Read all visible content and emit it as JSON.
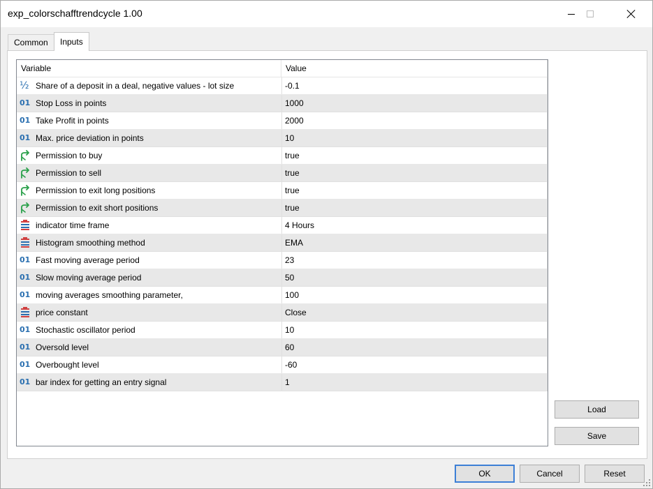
{
  "window": {
    "title": "exp_colorschafftrendcycle 1.00"
  },
  "tabs": [
    {
      "label": "Common",
      "active": false
    },
    {
      "label": "Inputs",
      "active": true
    }
  ],
  "grid": {
    "headers": {
      "variable": "Variable",
      "value": "Value"
    },
    "rows": [
      {
        "icon": "fraction-icon",
        "variable": "Share of a deposit in a deal, negative values - lot size",
        "value": "-0.1"
      },
      {
        "icon": "integer-icon",
        "variable": "Stop Loss in points",
        "value": "1000"
      },
      {
        "icon": "integer-icon",
        "variable": "Take Profit in points",
        "value": "2000"
      },
      {
        "icon": "integer-icon",
        "variable": "Max. price deviation in points",
        "value": "10"
      },
      {
        "icon": "bool-arrow-icon",
        "variable": "Permission to buy",
        "value": "true"
      },
      {
        "icon": "bool-arrow-icon",
        "variable": "Permission to sell",
        "value": "true"
      },
      {
        "icon": "bool-arrow-icon",
        "variable": "Permission to exit long positions",
        "value": "true"
      },
      {
        "icon": "bool-arrow-icon",
        "variable": "Permission to exit short positions",
        "value": "true"
      },
      {
        "icon": "enum-icon",
        "variable": "indicator time frame",
        "value": "4 Hours"
      },
      {
        "icon": "enum-icon",
        "variable": "Histogram smoothing method",
        "value": "EMA"
      },
      {
        "icon": "integer-icon",
        "variable": "Fast moving average period",
        "value": "23"
      },
      {
        "icon": "integer-icon",
        "variable": "Slow moving average period",
        "value": "50"
      },
      {
        "icon": "integer-icon",
        "variable": "moving averages smoothing parameter,",
        "value": "100"
      },
      {
        "icon": "enum-icon",
        "variable": "price constant",
        "value": "Close"
      },
      {
        "icon": "integer-icon",
        "variable": "Stochastic oscillator period",
        "value": "10"
      },
      {
        "icon": "integer-icon",
        "variable": "Oversold level",
        "value": "60"
      },
      {
        "icon": "integer-icon",
        "variable": "Overbought level",
        "value": "-60"
      },
      {
        "icon": "integer-icon",
        "variable": "bar index for getting an entry signal",
        "value": "1"
      }
    ]
  },
  "side_buttons": {
    "load": "Load",
    "save": "Save"
  },
  "footer_buttons": {
    "ok": "OK",
    "cancel": "Cancel",
    "reset": "Reset"
  },
  "colors": {
    "accent": "#3c7fd6",
    "icon_blue": "#2a6fb0",
    "icon_green": "#2aa04a",
    "icon_red": "#d04040"
  }
}
